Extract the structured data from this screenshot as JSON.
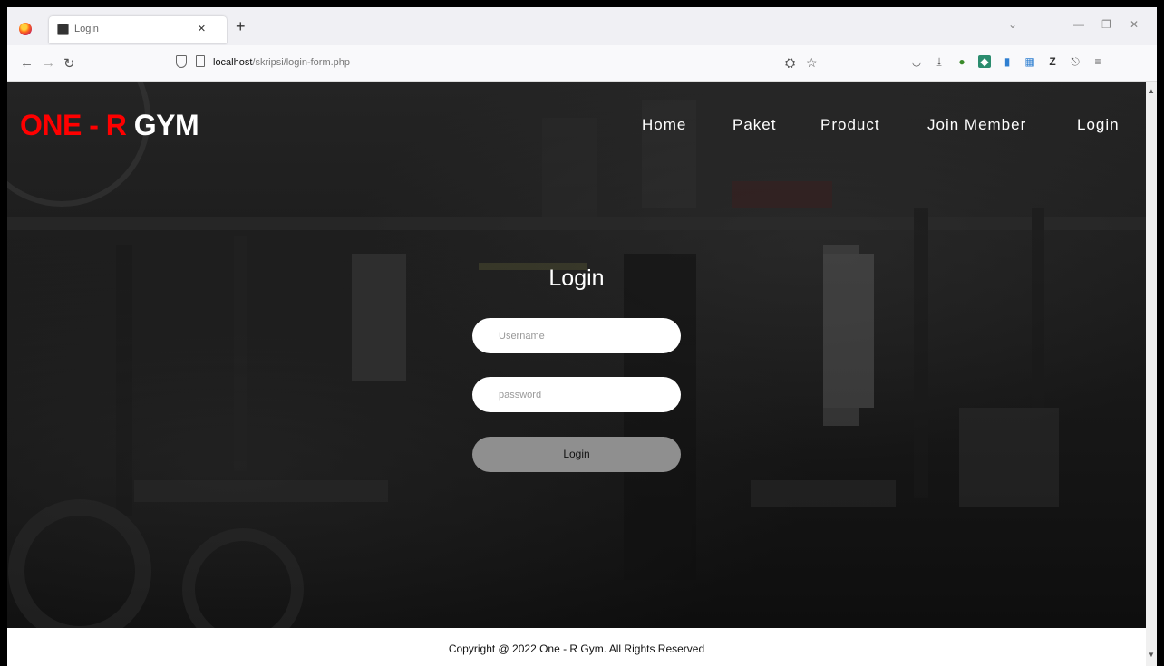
{
  "browser": {
    "tab_title": "Login",
    "url_host": "localhost",
    "url_path": "/skripsi/login-form.php",
    "icons": [
      "firefox-icon",
      "back-icon",
      "forward-icon",
      "reload-icon",
      "shield-icon",
      "page-icon",
      "translate-icon",
      "bookmark-star-icon",
      "pocket-icon",
      "download-icon",
      "extension-icon",
      "zotero-icon",
      "menu-icon"
    ]
  },
  "site": {
    "brand_red": "ONE - R",
    "brand_white": "GYM",
    "nav": [
      "Home",
      "Paket",
      "Product",
      "Join Member",
      "Login"
    ]
  },
  "login": {
    "title": "Login",
    "username_placeholder": "Username",
    "password_placeholder": "password",
    "button": "Login"
  },
  "footer": {
    "text": "Copyright @ 2022 One - R Gym. All Rights Reserved"
  },
  "colors": {
    "brand_red": "#ff0000",
    "button_gray": "#8f8f8f"
  }
}
